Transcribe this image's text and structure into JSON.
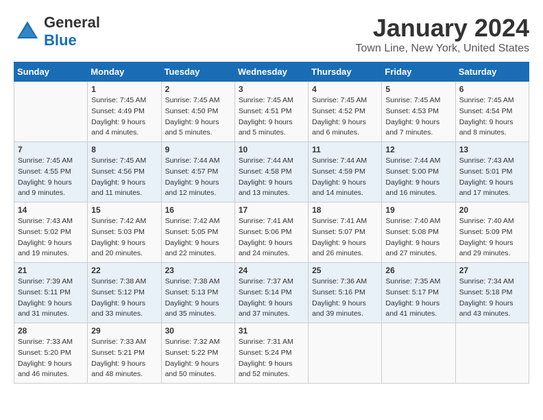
{
  "logo": {
    "general": "General",
    "blue": "Blue"
  },
  "header": {
    "month": "January 2024",
    "location": "Town Line, New York, United States"
  },
  "days_of_week": [
    "Sunday",
    "Monday",
    "Tuesday",
    "Wednesday",
    "Thursday",
    "Friday",
    "Saturday"
  ],
  "weeks": [
    [
      {
        "day": "",
        "info": ""
      },
      {
        "day": "1",
        "info": "Sunrise: 7:45 AM\nSunset: 4:49 PM\nDaylight: 9 hours\nand 4 minutes."
      },
      {
        "day": "2",
        "info": "Sunrise: 7:45 AM\nSunset: 4:50 PM\nDaylight: 9 hours\nand 5 minutes."
      },
      {
        "day": "3",
        "info": "Sunrise: 7:45 AM\nSunset: 4:51 PM\nDaylight: 9 hours\nand 5 minutes."
      },
      {
        "day": "4",
        "info": "Sunrise: 7:45 AM\nSunset: 4:52 PM\nDaylight: 9 hours\nand 6 minutes."
      },
      {
        "day": "5",
        "info": "Sunrise: 7:45 AM\nSunset: 4:53 PM\nDaylight: 9 hours\nand 7 minutes."
      },
      {
        "day": "6",
        "info": "Sunrise: 7:45 AM\nSunset: 4:54 PM\nDaylight: 9 hours\nand 8 minutes."
      }
    ],
    [
      {
        "day": "7",
        "info": "Sunrise: 7:45 AM\nSunset: 4:55 PM\nDaylight: 9 hours\nand 9 minutes."
      },
      {
        "day": "8",
        "info": "Sunrise: 7:45 AM\nSunset: 4:56 PM\nDaylight: 9 hours\nand 11 minutes."
      },
      {
        "day": "9",
        "info": "Sunrise: 7:44 AM\nSunset: 4:57 PM\nDaylight: 9 hours\nand 12 minutes."
      },
      {
        "day": "10",
        "info": "Sunrise: 7:44 AM\nSunset: 4:58 PM\nDaylight: 9 hours\nand 13 minutes."
      },
      {
        "day": "11",
        "info": "Sunrise: 7:44 AM\nSunset: 4:59 PM\nDaylight: 9 hours\nand 14 minutes."
      },
      {
        "day": "12",
        "info": "Sunrise: 7:44 AM\nSunset: 5:00 PM\nDaylight: 9 hours\nand 16 minutes."
      },
      {
        "day": "13",
        "info": "Sunrise: 7:43 AM\nSunset: 5:01 PM\nDaylight: 9 hours\nand 17 minutes."
      }
    ],
    [
      {
        "day": "14",
        "info": "Sunrise: 7:43 AM\nSunset: 5:02 PM\nDaylight: 9 hours\nand 19 minutes."
      },
      {
        "day": "15",
        "info": "Sunrise: 7:42 AM\nSunset: 5:03 PM\nDaylight: 9 hours\nand 20 minutes."
      },
      {
        "day": "16",
        "info": "Sunrise: 7:42 AM\nSunset: 5:05 PM\nDaylight: 9 hours\nand 22 minutes."
      },
      {
        "day": "17",
        "info": "Sunrise: 7:41 AM\nSunset: 5:06 PM\nDaylight: 9 hours\nand 24 minutes."
      },
      {
        "day": "18",
        "info": "Sunrise: 7:41 AM\nSunset: 5:07 PM\nDaylight: 9 hours\nand 26 minutes."
      },
      {
        "day": "19",
        "info": "Sunrise: 7:40 AM\nSunset: 5:08 PM\nDaylight: 9 hours\nand 27 minutes."
      },
      {
        "day": "20",
        "info": "Sunrise: 7:40 AM\nSunset: 5:09 PM\nDaylight: 9 hours\nand 29 minutes."
      }
    ],
    [
      {
        "day": "21",
        "info": "Sunrise: 7:39 AM\nSunset: 5:11 PM\nDaylight: 9 hours\nand 31 minutes."
      },
      {
        "day": "22",
        "info": "Sunrise: 7:38 AM\nSunset: 5:12 PM\nDaylight: 9 hours\nand 33 minutes."
      },
      {
        "day": "23",
        "info": "Sunrise: 7:38 AM\nSunset: 5:13 PM\nDaylight: 9 hours\nand 35 minutes."
      },
      {
        "day": "24",
        "info": "Sunrise: 7:37 AM\nSunset: 5:14 PM\nDaylight: 9 hours\nand 37 minutes."
      },
      {
        "day": "25",
        "info": "Sunrise: 7:36 AM\nSunset: 5:16 PM\nDaylight: 9 hours\nand 39 minutes."
      },
      {
        "day": "26",
        "info": "Sunrise: 7:35 AM\nSunset: 5:17 PM\nDaylight: 9 hours\nand 41 minutes."
      },
      {
        "day": "27",
        "info": "Sunrise: 7:34 AM\nSunset: 5:18 PM\nDaylight: 9 hours\nand 43 minutes."
      }
    ],
    [
      {
        "day": "28",
        "info": "Sunrise: 7:33 AM\nSunset: 5:20 PM\nDaylight: 9 hours\nand 46 minutes."
      },
      {
        "day": "29",
        "info": "Sunrise: 7:33 AM\nSunset: 5:21 PM\nDaylight: 9 hours\nand 48 minutes."
      },
      {
        "day": "30",
        "info": "Sunrise: 7:32 AM\nSunset: 5:22 PM\nDaylight: 9 hours\nand 50 minutes."
      },
      {
        "day": "31",
        "info": "Sunrise: 7:31 AM\nSunset: 5:24 PM\nDaylight: 9 hours\nand 52 minutes."
      },
      {
        "day": "",
        "info": ""
      },
      {
        "day": "",
        "info": ""
      },
      {
        "day": "",
        "info": ""
      }
    ]
  ]
}
